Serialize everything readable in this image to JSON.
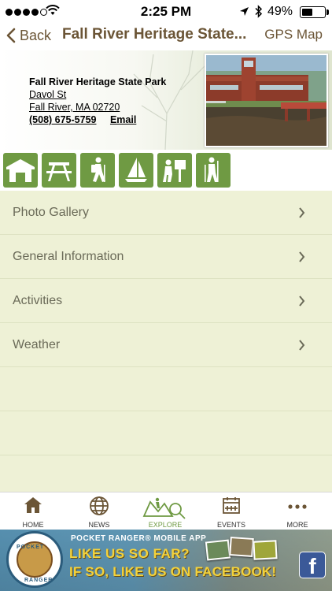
{
  "status_bar": {
    "time": "2:25 PM",
    "battery_text": "49%",
    "battery_level": 0.49,
    "signal_bars_filled": 4,
    "signal_bars_total": 5
  },
  "nav": {
    "back_label": "Back",
    "title": "Fall River Heritage State...",
    "right_label": "GPS Map"
  },
  "park": {
    "name": "Fall River Heritage State Park",
    "street": "Davol St",
    "city": "Fall River, MA 02720",
    "phone": "(508) 675-5759",
    "email_label": "Email"
  },
  "activities": [
    {
      "icon": "cabin-icon"
    },
    {
      "icon": "picnic-table-icon"
    },
    {
      "icon": "hiking-icon"
    },
    {
      "icon": "sailing-icon"
    },
    {
      "icon": "interpretive-center-icon"
    },
    {
      "icon": "walking-trail-icon"
    }
  ],
  "menu": [
    {
      "label": "Photo Gallery"
    },
    {
      "label": "General Information"
    },
    {
      "label": "Activities"
    },
    {
      "label": "Weather"
    }
  ],
  "tabs": [
    {
      "label": "HOME",
      "icon": "home-icon"
    },
    {
      "label": "NEWS",
      "icon": "globe-icon"
    },
    {
      "label": "EXPLORE",
      "icon": "explore-map-icon",
      "active": true
    },
    {
      "label": "EVENTS",
      "icon": "calendar-icon"
    },
    {
      "label": "MORE",
      "icon": "more-dots-icon"
    }
  ],
  "banner": {
    "logo_top": "POCKET",
    "logo_bottom": "RANGER",
    "app_line": "POCKET RANGER® MOBILE APP",
    "line1": "LIKE US SO FAR?",
    "line2": "IF SO, LIKE US ON FACEBOOK!",
    "fb_letter": "f"
  },
  "colors": {
    "brand_brown": "#6b5536",
    "activity_green": "#6f9a43",
    "list_background": "#eef1d6"
  }
}
